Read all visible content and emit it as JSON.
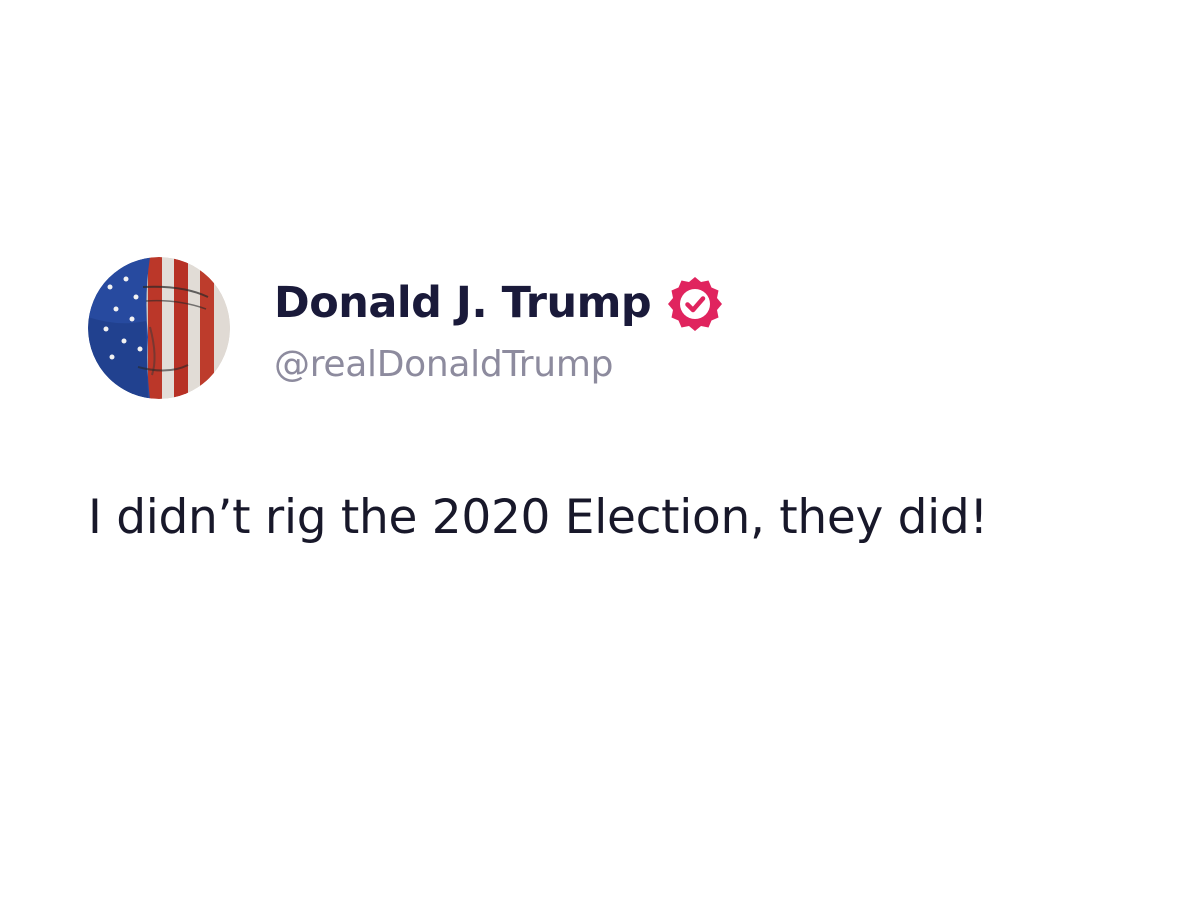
{
  "post": {
    "author": {
      "display_name": "Donald J. Trump",
      "handle": "@realDonaldTrump",
      "verified_icon": "verified-badge-icon",
      "avatar": "avatar-image"
    },
    "text": "I didn’t rig the 2020 Election, they did!"
  },
  "colors": {
    "name": "#1a1a3a",
    "handle": "#8d8b9e",
    "body": "#18182a",
    "verified_badge": "#e0245e"
  }
}
